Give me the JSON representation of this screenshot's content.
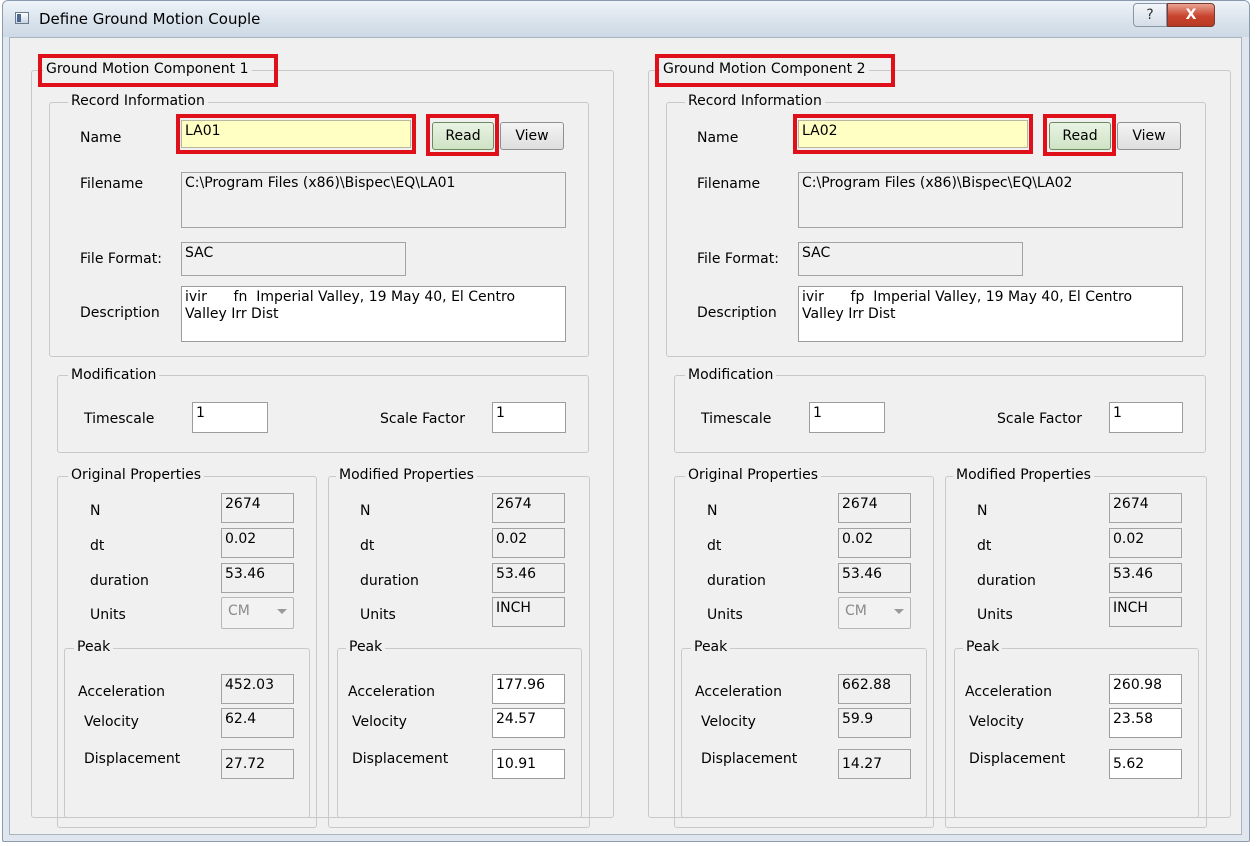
{
  "window": {
    "title": "Define Ground Motion Couple",
    "help_label": "?",
    "close_label": "X"
  },
  "components": [
    {
      "group_label": "Ground Motion Component 1",
      "record_info_label": "Record Information",
      "name_label": "Name",
      "name_value": "LA01",
      "read_label": "Read",
      "view_label": "View",
      "filename_label": "Filename",
      "filename_value": "C:\\Program Files (x86)\\Bispec\\EQ\\LA01",
      "file_format_label": "File Format:",
      "file_format_value": "SAC",
      "description_label": "Description",
      "description_value": "ivir      fn  Imperial Valley, 19 May 40, El Centro\nValley Irr Dist",
      "modification_label": "Modification",
      "timescale_label": "Timescale",
      "timescale_value": "1",
      "scale_factor_label": "Scale Factor",
      "scale_factor_value": "1",
      "original": {
        "group_label": "Original Properties",
        "n_label": "N",
        "n_value": "2674",
        "dt_label": "dt",
        "dt_value": "0.02",
        "duration_label": "duration",
        "duration_value": "53.46",
        "units_label": "Units",
        "units_value": "CM",
        "peak_label": "Peak",
        "acceleration_label": "Acceleration",
        "acceleration_value": "452.03",
        "velocity_label": "Velocity",
        "velocity_value": "62.4",
        "displacement_label": "Displacement",
        "displacement_value": "27.72"
      },
      "modified": {
        "group_label": "Modified Properties",
        "n_label": "N",
        "n_value": "2674",
        "dt_label": "dt",
        "dt_value": "0.02",
        "duration_label": "duration",
        "duration_value": "53.46",
        "units_label": "Units",
        "units_value": "INCH",
        "peak_label": "Peak",
        "acceleration_label": "Acceleration",
        "acceleration_value": "177.96",
        "velocity_label": "Velocity",
        "velocity_value": "24.57",
        "displacement_label": "Displacement",
        "displacement_value": "10.91"
      }
    },
    {
      "group_label": "Ground Motion Component 2",
      "record_info_label": "Record Information",
      "name_label": "Name",
      "name_value": "LA02",
      "read_label": "Read",
      "view_label": "View",
      "filename_label": "Filename",
      "filename_value": "C:\\Program Files (x86)\\Bispec\\EQ\\LA02",
      "file_format_label": "File Format:",
      "file_format_value": "SAC",
      "description_label": "Description",
      "description_value": "ivir      fp  Imperial Valley, 19 May 40, El Centro\nValley Irr Dist",
      "modification_label": "Modification",
      "timescale_label": "Timescale",
      "timescale_value": "1",
      "scale_factor_label": "Scale Factor",
      "scale_factor_value": "1",
      "original": {
        "group_label": "Original Properties",
        "n_label": "N",
        "n_value": "2674",
        "dt_label": "dt",
        "dt_value": "0.02",
        "duration_label": "duration",
        "duration_value": "53.46",
        "units_label": "Units",
        "units_value": "CM",
        "peak_label": "Peak",
        "acceleration_label": "Acceleration",
        "acceleration_value": "662.88",
        "velocity_label": "Velocity",
        "velocity_value": "59.9",
        "displacement_label": "Displacement",
        "displacement_value": "14.27"
      },
      "modified": {
        "group_label": "Modified Properties",
        "n_label": "N",
        "n_value": "2674",
        "dt_label": "dt",
        "dt_value": "0.02",
        "duration_label": "duration",
        "duration_value": "53.46",
        "units_label": "Units",
        "units_value": "INCH",
        "peak_label": "Peak",
        "acceleration_label": "Acceleration",
        "acceleration_value": "260.98",
        "velocity_label": "Velocity",
        "velocity_value": "23.58",
        "displacement_label": "Displacement",
        "displacement_value": "5.62"
      }
    }
  ],
  "colors": {
    "highlight_border": "#e0101a",
    "name_field_fill": "#ffffc4"
  }
}
